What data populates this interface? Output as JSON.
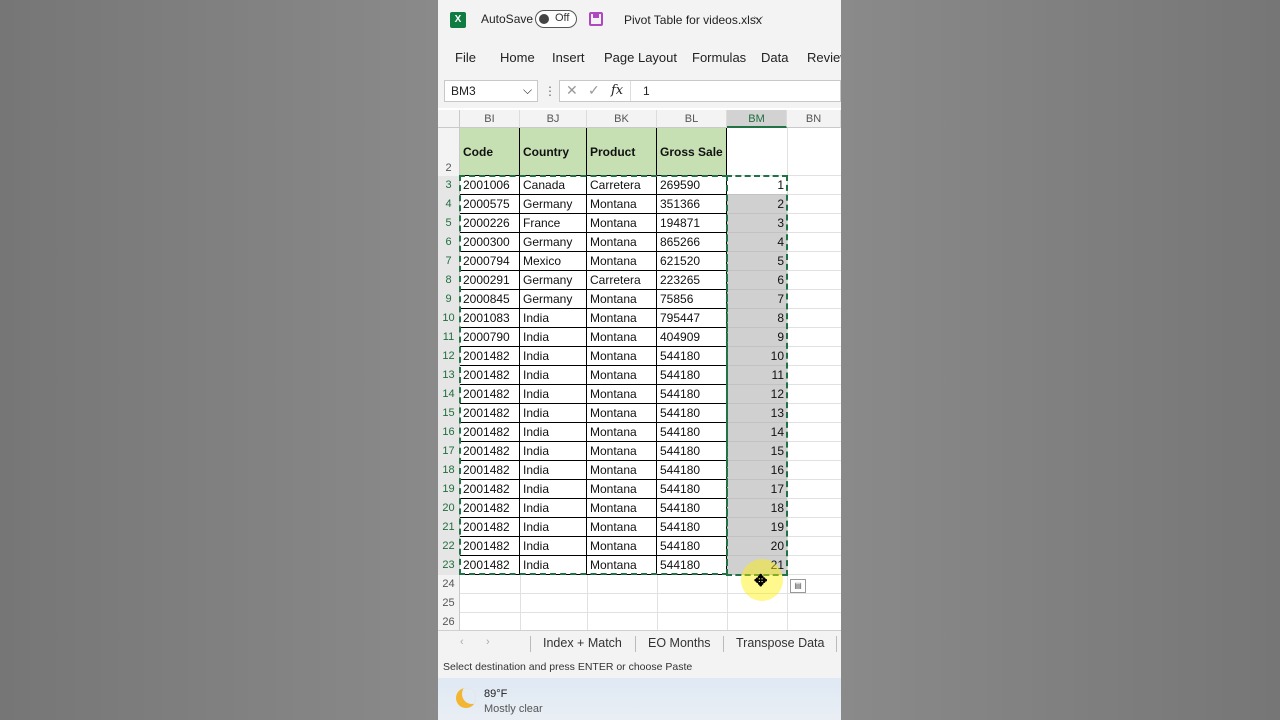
{
  "titlebar": {
    "autosave_label": "AutoSave",
    "toggle_state": "Off",
    "filename": "Pivot Table for videos.xlsx",
    "dropdown": "⌵"
  },
  "ribbon": {
    "tabs": [
      "File",
      "Home",
      "Insert",
      "Page Layout",
      "Formulas",
      "Data",
      "Review"
    ]
  },
  "formula_bar": {
    "name_box": "BM3",
    "fx": "fx",
    "value": "1",
    "cancel_glyph": "✕",
    "enter_glyph": "✓",
    "dots": "⋮"
  },
  "grid": {
    "columns": [
      "BI",
      "BJ",
      "BK",
      "BL",
      "BM",
      "BN"
    ],
    "selected_column": "BM",
    "header_row": {
      "number": "2",
      "labels": [
        "Code",
        "Country",
        "Product",
        "Gross Sale"
      ]
    },
    "rows": [
      {
        "n": "3",
        "code": "2001006",
        "country": "Canada",
        "product": "Carretera",
        "sale": "269590",
        "bm": "1"
      },
      {
        "n": "4",
        "code": "2000575",
        "country": "Germany",
        "product": "Montana",
        "sale": "351366",
        "bm": "2"
      },
      {
        "n": "5",
        "code": "2000226",
        "country": "France",
        "product": "Montana",
        "sale": "194871",
        "bm": "3"
      },
      {
        "n": "6",
        "code": "2000300",
        "country": "Germany",
        "product": "Montana",
        "sale": "865266",
        "bm": "4"
      },
      {
        "n": "7",
        "code": "2000794",
        "country": "Mexico",
        "product": "Montana",
        "sale": "621520",
        "bm": "5"
      },
      {
        "n": "8",
        "code": "2000291",
        "country": "Germany",
        "product": "Carretera",
        "sale": "223265",
        "bm": "6"
      },
      {
        "n": "9",
        "code": "2000845",
        "country": "Germany",
        "product": "Montana",
        "sale": "75856",
        "bm": "7"
      },
      {
        "n": "10",
        "code": "2001083",
        "country": "India",
        "product": "Montana",
        "sale": "795447",
        "bm": "8"
      },
      {
        "n": "11",
        "code": "2000790",
        "country": "India",
        "product": "Montana",
        "sale": "404909",
        "bm": "9"
      },
      {
        "n": "12",
        "code": "2001482",
        "country": "India",
        "product": "Montana",
        "sale": "544180",
        "bm": "10"
      },
      {
        "n": "13",
        "code": "2001482",
        "country": "India",
        "product": "Montana",
        "sale": "544180",
        "bm": "11"
      },
      {
        "n": "14",
        "code": "2001482",
        "country": "India",
        "product": "Montana",
        "sale": "544180",
        "bm": "12"
      },
      {
        "n": "15",
        "code": "2001482",
        "country": "India",
        "product": "Montana",
        "sale": "544180",
        "bm": "13"
      },
      {
        "n": "16",
        "code": "2001482",
        "country": "India",
        "product": "Montana",
        "sale": "544180",
        "bm": "14"
      },
      {
        "n": "17",
        "code": "2001482",
        "country": "India",
        "product": "Montana",
        "sale": "544180",
        "bm": "15"
      },
      {
        "n": "18",
        "code": "2001482",
        "country": "India",
        "product": "Montana",
        "sale": "544180",
        "bm": "16"
      },
      {
        "n": "19",
        "code": "2001482",
        "country": "India",
        "product": "Montana",
        "sale": "544180",
        "bm": "17"
      },
      {
        "n": "20",
        "code": "2001482",
        "country": "India",
        "product": "Montana",
        "sale": "544180",
        "bm": "18"
      },
      {
        "n": "21",
        "code": "2001482",
        "country": "India",
        "product": "Montana",
        "sale": "544180",
        "bm": "19"
      },
      {
        "n": "22",
        "code": "2001482",
        "country": "India",
        "product": "Montana",
        "sale": "544180",
        "bm": "20"
      },
      {
        "n": "23",
        "code": "2001482",
        "country": "India",
        "product": "Montana",
        "sale": "544180",
        "bm": "21"
      }
    ],
    "empty_rows": [
      "24",
      "25",
      "26"
    ]
  },
  "sheet_tabs": {
    "prev": "‹",
    "next": "›",
    "tabs": [
      "Index + Match",
      "EO Months",
      "Transpose Data"
    ]
  },
  "status_bar": {
    "message": "Select destination and press ENTER or choose Paste"
  },
  "weather": {
    "temperature": "89°F",
    "condition": "Mostly clear"
  },
  "colors": {
    "excel_green": "#217346",
    "header_fill": "#c6e0b4",
    "selection_fill": "#d0d0d0"
  }
}
